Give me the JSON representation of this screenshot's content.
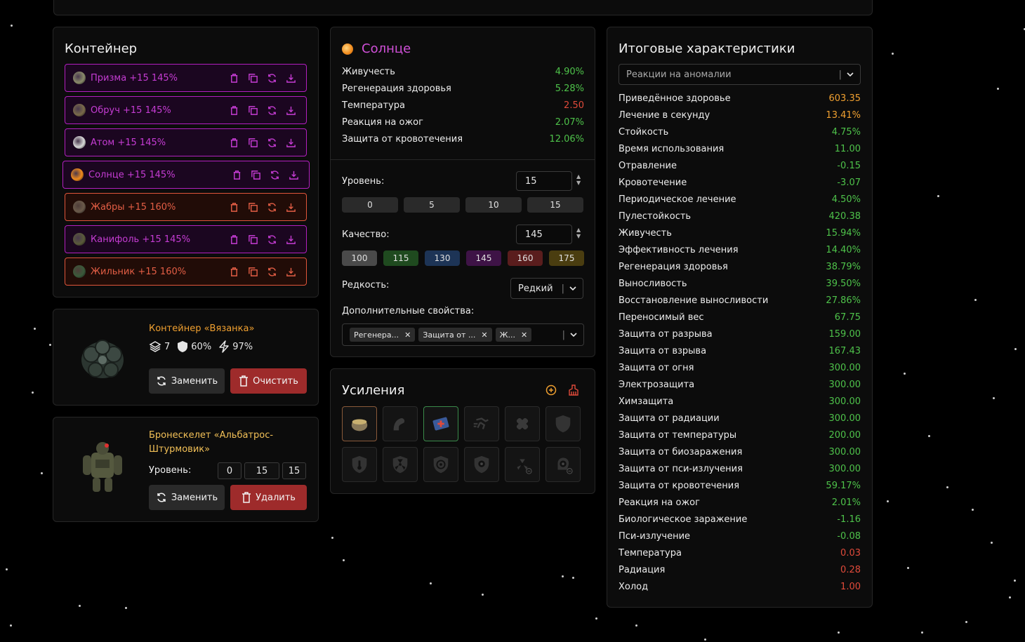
{
  "container_panel": {
    "title": "Контейнер",
    "artifacts": [
      {
        "label": "Призма +15 145%",
        "color": "purple",
        "icon": "prism-artifact-icon"
      },
      {
        "label": "Обруч +15 145%",
        "color": "purple",
        "icon": "hoop-artifact-icon"
      },
      {
        "label": "Атом +15 145%",
        "color": "purple",
        "icon": "atom-artifact-icon"
      },
      {
        "label": "Солнце +15 145%",
        "color": "purple",
        "icon": "sun-artifact-icon",
        "selected": true
      },
      {
        "label": "Жабры +15 160%",
        "color": "orange",
        "icon": "gills-artifact-icon"
      },
      {
        "label": "Канифоль +15 145%",
        "color": "purple",
        "icon": "rosin-artifact-icon"
      },
      {
        "label": "Жильник +15 160%",
        "color": "orange",
        "icon": "vein-artifact-icon"
      }
    ]
  },
  "bag": {
    "name": "Контейнер «Вязанка»",
    "slots": "7",
    "protection": "60%",
    "efficiency": "97%",
    "replace_label": "Заменить",
    "clear_label": "Очистить"
  },
  "armor": {
    "name_line1": "Бронескелет «Альбатрос-",
    "name_line2": "Штурмовик»",
    "level_label": "Уровень:",
    "levels": [
      "0",
      "15",
      "15"
    ],
    "replace_label": "Заменить",
    "delete_label": "Удалить"
  },
  "sun_panel": {
    "title": "Солнце",
    "stats": [
      {
        "name": "Живучесть",
        "value": "4.90%",
        "tone": "g"
      },
      {
        "name": "Регенерация здоровья",
        "value": "5.28%",
        "tone": "g"
      },
      {
        "name": "Температура",
        "value": "2.50",
        "tone": "r"
      },
      {
        "name": "Реакция на ожог",
        "value": "2.07%",
        "tone": "g"
      },
      {
        "name": "Защита от кровотечения",
        "value": "12.06%",
        "tone": "g"
      }
    ],
    "level_label": "Уровень:",
    "level_value": "15",
    "level_presets": [
      "0",
      "5",
      "10",
      "15"
    ],
    "quality_label": "Качество:",
    "quality_value": "145",
    "quality_presets": [
      {
        "label": "100",
        "color": "#4a4a4a"
      },
      {
        "label": "115",
        "color": "#1f4a1f"
      },
      {
        "label": "130",
        "color": "#1d3456"
      },
      {
        "label": "145",
        "color": "#3e1346"
      },
      {
        "label": "160",
        "color": "#5a1d1d"
      },
      {
        "label": "175",
        "color": "#4a3d10"
      }
    ],
    "rarity_label": "Редкость:",
    "rarity_value": "Редкий",
    "extra_label": "Дополнительные свойства:",
    "extra_tags": [
      "Регенера...",
      "Защита от ...",
      "Ж..."
    ]
  },
  "boosts": {
    "title": "Усиления",
    "cells": [
      {
        "icon": "pot-food-icon",
        "active": "orange"
      },
      {
        "icon": "strength-arm-icon",
        "active": ""
      },
      {
        "icon": "medkit-icon",
        "active": "green"
      },
      {
        "icon": "sprint-icon",
        "active": ""
      },
      {
        "icon": "bandage-icon",
        "active": ""
      },
      {
        "icon": "shield-icon",
        "active": ""
      },
      {
        "icon": "thermo-shield-icon",
        "active": ""
      },
      {
        "icon": "radiation-shield-icon",
        "active": ""
      },
      {
        "icon": "biohazard-shield-icon",
        "active": ""
      },
      {
        "icon": "psy-shield-icon",
        "active": ""
      },
      {
        "icon": "radiation-minus-icon",
        "active": ""
      },
      {
        "icon": "psy-minus-icon",
        "active": ""
      }
    ]
  },
  "totals": {
    "title": "Итоговые характеристики",
    "filter_value": "Реакции на аномалии",
    "rows": [
      {
        "name": "Приведённое здоровье",
        "value": "603.35",
        "tone": "o"
      },
      {
        "name": "Лечение в секунду",
        "value": "13.41%",
        "tone": "o"
      },
      {
        "name": "Стойкость",
        "value": "4.75%",
        "tone": "g"
      },
      {
        "name": "Время использования",
        "value": "11.00",
        "tone": "g"
      },
      {
        "name": "Отравление",
        "value": "-0.15",
        "tone": "g"
      },
      {
        "name": "Кровотечение",
        "value": "-3.07",
        "tone": "g"
      },
      {
        "name": "Периодическое лечение",
        "value": "4.50%",
        "tone": "g"
      },
      {
        "name": "Пулестойкость",
        "value": "420.38",
        "tone": "g"
      },
      {
        "name": "Живучесть",
        "value": "15.94%",
        "tone": "g"
      },
      {
        "name": "Эффективность лечения",
        "value": "14.40%",
        "tone": "g"
      },
      {
        "name": "Регенерация здоровья",
        "value": "38.79%",
        "tone": "g"
      },
      {
        "name": "Выносливость",
        "value": "39.50%",
        "tone": "g"
      },
      {
        "name": "Восстановление выносливости",
        "value": "27.86%",
        "tone": "g"
      },
      {
        "name": "Переносимый вес",
        "value": "67.75",
        "tone": "g"
      },
      {
        "name": "Защита от разрыва",
        "value": "159.00",
        "tone": "g"
      },
      {
        "name": "Защита от взрыва",
        "value": "167.43",
        "tone": "g"
      },
      {
        "name": "Защита от огня",
        "value": "300.00",
        "tone": "g"
      },
      {
        "name": "Электрозащита",
        "value": "300.00",
        "tone": "g"
      },
      {
        "name": "Химзащита",
        "value": "300.00",
        "tone": "g"
      },
      {
        "name": "Защита от радиации",
        "value": "300.00",
        "tone": "g"
      },
      {
        "name": "Защита от температуры",
        "value": "200.00",
        "tone": "g"
      },
      {
        "name": "Защита от биозаражения",
        "value": "300.00",
        "tone": "g"
      },
      {
        "name": "Защита от пси-излучения",
        "value": "300.00",
        "tone": "g"
      },
      {
        "name": "Защита от кровотечения",
        "value": "59.17%",
        "tone": "g"
      },
      {
        "name": "Реакция на ожог",
        "value": "2.01%",
        "tone": "g"
      },
      {
        "name": "Биологическое заражение",
        "value": "-1.16",
        "tone": "g"
      },
      {
        "name": "Пси-излучение",
        "value": "-0.08",
        "tone": "g"
      },
      {
        "name": "Температура",
        "value": "0.03",
        "tone": "r"
      },
      {
        "name": "Радиация",
        "value": "0.28",
        "tone": "r"
      },
      {
        "name": "Холод",
        "value": "1.00",
        "tone": "r"
      }
    ]
  }
}
